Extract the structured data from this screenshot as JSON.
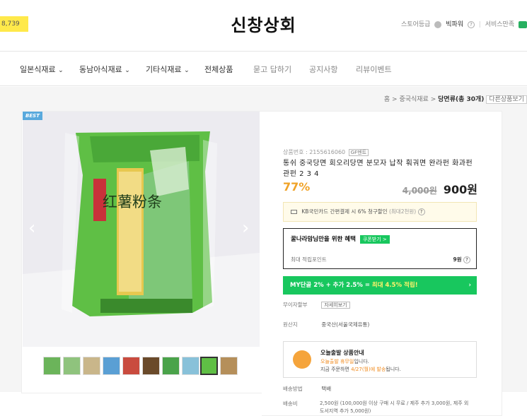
{
  "header": {
    "cart_count": "8,739",
    "store_name": "신창상회",
    "store_grade": "스토어등급",
    "grade_name": "빅파워",
    "help": "?",
    "service_label": "서비스만족"
  },
  "nav": {
    "items": [
      {
        "label": "일본식재료"
      },
      {
        "label": "동남아식재료"
      },
      {
        "label": "기타식재료"
      },
      {
        "label": "전체상품"
      },
      {
        "label": "묻고 답하기"
      },
      {
        "label": "공지사항"
      },
      {
        "label": "리뷰이벤트"
      }
    ],
    "dropdown_marker": "⌄"
  },
  "breadcrumb": {
    "home": "홈",
    "sep": ">",
    "category": "중국식재료",
    "current": "당면류(총 30개)",
    "other": "다른상품보기"
  },
  "product": {
    "best_tag": "BEST",
    "prev_arrow": "‹",
    "next_arrow": "›",
    "code_label": "상품번호 : 2155616060",
    "gf_badge": "GF멘트",
    "name": "통쉬 중국당면 회오리당면 분모자 납작 훠궈면 완라펀 화과펀 관펀 2 3 4",
    "discount": "77%",
    "original_price": "4,000원",
    "final_price": "900원",
    "image_text": "红薯粉条",
    "thumbnail_count": 10
  },
  "card_promo": {
    "text": "KB국민카드 간편결제 시 6% 청구할인",
    "limit": "(최대2천원)",
    "help": "?"
  },
  "benefit": {
    "title": "꿀나라맘님만을 위한 혜택",
    "coupon_button": "쿠폰받기 >",
    "points_label": "최대 적립포인트",
    "points_value": "9원",
    "help": "?"
  },
  "my_promo": {
    "prefix": "MY단골 2% + 추가 2.5% =",
    "highlight": "최대 4.5% 적립!",
    "arrow": "›"
  },
  "rows": {
    "interest_label": "무이자할부",
    "interest_button": "자세히보기",
    "origin_label": "원산지",
    "origin_value": "중국산(서울국제유통)",
    "ship_method_label": "배송방법",
    "ship_method_value": "택배",
    "ship_fee_label": "배송비",
    "ship_fee_value": "2,500원 (100,000원 이상 구매 시 무료 / 제주 추가 3,000원, 제주 외 도서지역 추가 5,000원)"
  },
  "today_ship": {
    "title": "오늘출발 상품안내",
    "line1_highlight": "오늘출발 휴무일",
    "line1_suffix": "입니다.",
    "line2_prefix": "지금 주문하면",
    "line2_highlight": "4/27(월)에 발송",
    "line2_suffix": "됩니다."
  },
  "colors": {
    "accent_green": "#18c75e",
    "discount_orange": "#f0a328",
    "cart_yellow": "#ffe94a",
    "best_blue": "#59a9dd"
  }
}
